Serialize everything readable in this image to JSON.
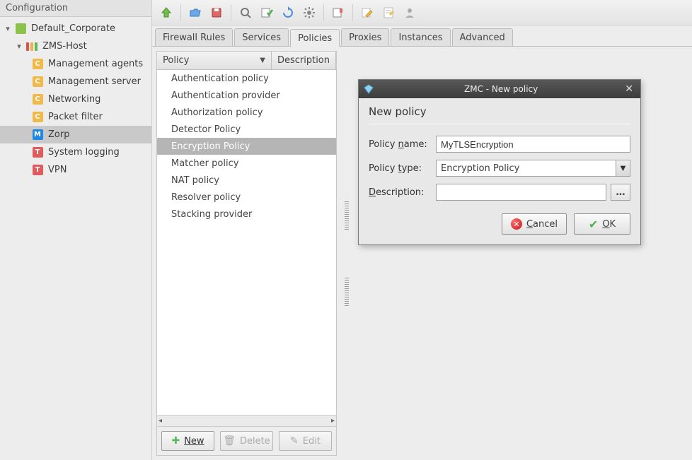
{
  "sidebar": {
    "title": "Configuration",
    "nodes": {
      "root": "Default_Corporate",
      "host": "ZMS-Host",
      "children": [
        "Management agents",
        "Management server",
        "Networking",
        "Packet filter",
        "Zorp",
        "System logging",
        "VPN"
      ]
    }
  },
  "tabs": [
    "Firewall Rules",
    "Services",
    "Policies",
    "Proxies",
    "Instances",
    "Advanced"
  ],
  "active_tab_index": 2,
  "policy_table": {
    "columns": {
      "policy": "Policy",
      "description": "Description"
    },
    "items": [
      "Authentication policy",
      "Authentication provider",
      "Authorization policy",
      "Detector Policy",
      "Encryption Policy",
      "Matcher policy",
      "NAT policy",
      "Resolver policy",
      "Stacking provider"
    ],
    "selected_index": 4
  },
  "policy_buttons": {
    "new": "New",
    "delete": "Delete",
    "edit": "Edit"
  },
  "dialog": {
    "window_title": "ZMC - New policy",
    "heading": "New policy",
    "labels": {
      "name": "Policy name:",
      "type": "Policy type:",
      "description": "Description:"
    },
    "values": {
      "name": "MyTLSEncryption",
      "type": "Encryption Policy",
      "description": ""
    },
    "buttons": {
      "cancel": "Cancel",
      "ok": "OK"
    }
  }
}
